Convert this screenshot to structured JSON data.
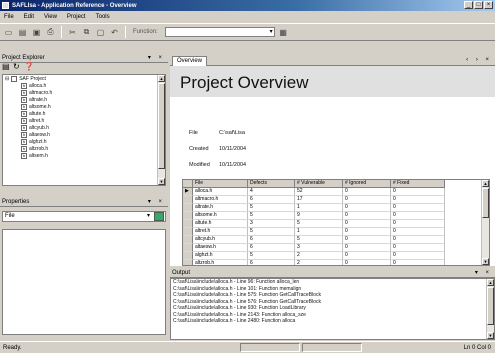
{
  "window": {
    "title": "SAFLIsa - Application Reference - Overview",
    "minimize": "_",
    "maximize": "□",
    "close": "×"
  },
  "menu": [
    "File",
    "Edit",
    "View",
    "Project",
    "Tools"
  ],
  "toolbar": {
    "label": "Function:",
    "combo_value": "",
    "combo_arrow": "▾"
  },
  "project_explorer": {
    "title": "Project Explorer",
    "controls": "▾ ×",
    "root_label": "SAF Project",
    "files": [
      "alloca.h",
      "altmacro.h",
      "altrate.h",
      "altsome.h",
      "altute.h",
      "altret.h",
      "altcyub.h",
      "altaesw.h",
      "alghzt.h",
      "altzrob.h",
      "altsem.h"
    ]
  },
  "properties": {
    "title": "Properties",
    "controls": "▾ ×",
    "combo_value": "File",
    "combo_arrow": "▾"
  },
  "document": {
    "tab_label": "Overview",
    "tab_nav": "‹ › ×",
    "title": "Project Overview",
    "info": [
      {
        "key": "File",
        "value": "C:\\saf\\Lisa"
      },
      {
        "key": "Created",
        "value": "10/11/2004"
      },
      {
        "key": "Modified",
        "value": "10/11/2004"
      }
    ],
    "grid": {
      "headers": [
        "File",
        "Defects",
        "# Vulnerable",
        "# Ignored",
        "# Fixed"
      ],
      "rows": [
        [
          "alloca.h",
          "4",
          "52",
          "0",
          "0"
        ],
        [
          "altmacro.h",
          "6",
          "17",
          "0",
          "0"
        ],
        [
          "altrate.h",
          "5",
          "1",
          "0",
          "0"
        ],
        [
          "altsome.h",
          "5",
          "9",
          "0",
          "0"
        ],
        [
          "altute.h",
          "3",
          "5",
          "0",
          "0"
        ],
        [
          "altret.h",
          "5",
          "1",
          "0",
          "0"
        ],
        [
          "altcyub.h",
          "6",
          "5",
          "0",
          "0"
        ],
        [
          "altaesw.h",
          "6",
          "3",
          "0",
          "0"
        ],
        [
          "alghzt.h",
          "5",
          "2",
          "0",
          "0"
        ],
        [
          "altzrob.h",
          "6",
          "2",
          "0",
          "0"
        ]
      ]
    }
  },
  "output": {
    "title": "Output",
    "controls": "▾ ×",
    "lines": [
      "C:\\saf\\Lisa\\include\\alloca.h - Line 96: Function alloca_len",
      "C:\\saf\\Lisa\\include\\alloca.h - Line 101: Function memalign",
      "C:\\saf\\Lisa\\include\\alloca.h - Line 575: Function GetCallTraceBlock",
      "C:\\saf\\Lisa\\include\\alloca.h - Line 576: Function GetCallTraceBlock",
      "C:\\saf\\Lisa\\include\\alloca.h - Line 930: Function LoadLibrary",
      "C:\\saf\\Lisa\\include\\alloca.h - Line 2143: Function alloca_sze",
      "C:\\saf\\Lisa\\include\\alloca.h - Line 2480: Function alloca"
    ]
  },
  "status": {
    "text": "Ready.",
    "position": "Ln 0 Col 0"
  }
}
